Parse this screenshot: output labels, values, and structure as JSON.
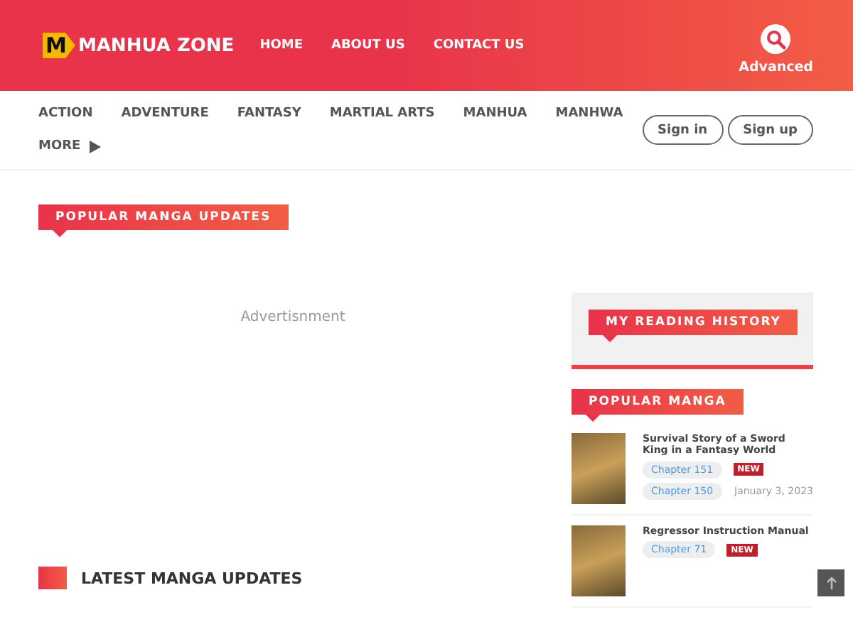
{
  "header": {
    "logo_mark": "M",
    "logo_text": "MANHUA ZONE",
    "nav": [
      "HOME",
      "ABOUT US",
      "CONTACT US"
    ],
    "advanced": "Advanced"
  },
  "categories": [
    "ACTION",
    "ADVENTURE",
    "FANTASY",
    "MARTIAL ARTS",
    "MANHUA",
    "MANHWA"
  ],
  "more": "MORE",
  "auth": [
    "Sign in",
    "Sign up"
  ],
  "popular_updates": {
    "title": "POPULAR MANGA UPDATES",
    "ad": "Advertisnment"
  },
  "latest": {
    "title": "LATEST MANGA UPDATES"
  },
  "reading_history": {
    "title": "MY READING HISTORY"
  },
  "popular_manga": {
    "title": "POPULAR MANGA",
    "items": [
      {
        "title": "Survival Story of a Sword King in a Fantasy World",
        "chapters": [
          {
            "label": "Chapter 151",
            "badge": "NEW"
          },
          {
            "label": "Chapter 150",
            "date": "January 3, 2023"
          }
        ]
      },
      {
        "title": "Regressor Instruction Manual",
        "chapters": [
          {
            "label": "Chapter 71",
            "badge": "NEW"
          }
        ]
      }
    ]
  }
}
